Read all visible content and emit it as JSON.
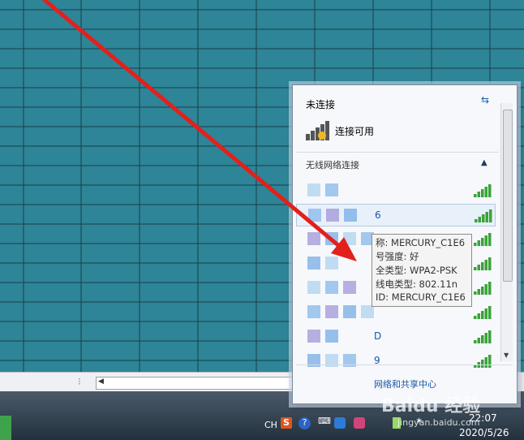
{
  "popup": {
    "status_title": "未连接",
    "connection_available": "连接可用",
    "section_title": "无线网络连接",
    "networks": [
      {
        "name": ""
      },
      {
        "name": "6",
        "selected": true
      },
      {
        "name": ""
      },
      {
        "name": ""
      },
      {
        "name": ""
      },
      {
        "name": ""
      },
      {
        "name": "D"
      },
      {
        "name": "9"
      }
    ],
    "footer_link": "网络和共享中心"
  },
  "tooltip": {
    "lines": [
      "称: MERCURY_C1E6",
      "号强度: 好",
      "全类型: WPA2-PSK",
      "线电类型: 802.11n",
      "ID: MERCURY_C1E6"
    ]
  },
  "taskbar": {
    "lang": "CH",
    "time": "22:07",
    "date": "2020/5/26"
  },
  "watermark": {
    "brand": "Baidu 经验",
    "url": "jingyan.baidu.com"
  },
  "colors": {
    "sheet_bg": "#2d8597",
    "arrow": "#e3201b",
    "link": "#1a56a6"
  }
}
